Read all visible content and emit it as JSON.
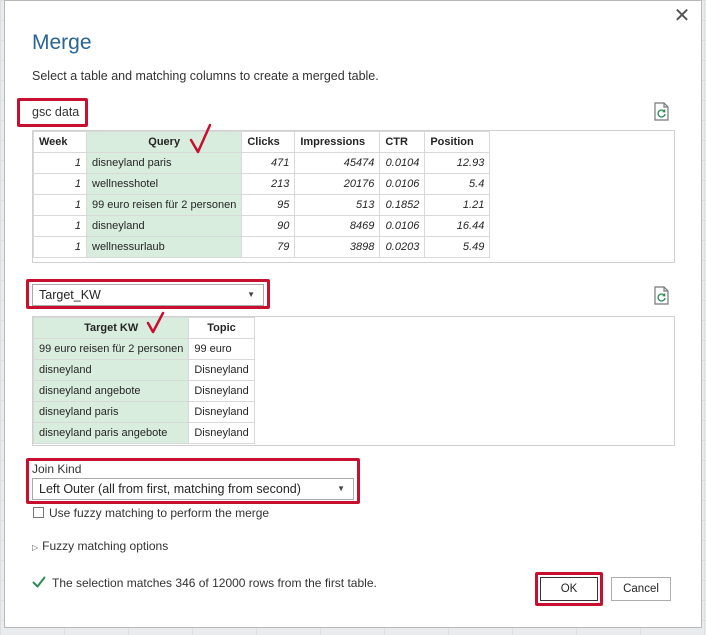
{
  "dialog": {
    "title": "Merge",
    "subtitle": "Select a table and matching columns to create a merged table.",
    "close_glyph": "✕"
  },
  "first_table": {
    "name": "gsc data",
    "columns": [
      "Week",
      "Query",
      "Clicks",
      "Impressions",
      "CTR",
      "Position"
    ],
    "rows": [
      [
        "1",
        "disneyland paris",
        "471",
        "45474",
        "0.0104",
        "12.93"
      ],
      [
        "1",
        "wellnesshotel",
        "213",
        "20176",
        "0.0106",
        "5.4"
      ],
      [
        "1",
        "99 euro reisen für 2 personen",
        "95",
        "513",
        "0.1852",
        "1.21"
      ],
      [
        "1",
        "disneyland",
        "90",
        "8469",
        "0.0106",
        "16.44"
      ],
      [
        "1",
        "wellnessurlaub",
        "79",
        "3898",
        "0.0203",
        "5.49"
      ]
    ]
  },
  "second_table": {
    "selected": "Target_KW",
    "columns": [
      "Target KW",
      "Topic"
    ],
    "rows": [
      [
        "99 euro reisen für 2 personen",
        "99 euro"
      ],
      [
        "disneyland",
        "Disneyland"
      ],
      [
        "disneyland angebote",
        "Disneyland"
      ],
      [
        "disneyland paris",
        "Disneyland"
      ],
      [
        "disneyland paris angebote",
        "Disneyland"
      ]
    ]
  },
  "join": {
    "label": "Join Kind",
    "value": "Left Outer (all from first, matching from second)"
  },
  "fuzzy": {
    "checkbox_label": "Use fuzzy matching to perform the merge",
    "checked": false,
    "options_label": "Fuzzy matching options"
  },
  "status": {
    "text": "The selection matches 346 of 12000 rows from the first table."
  },
  "buttons": {
    "ok": "OK",
    "cancel": "Cancel"
  },
  "colors": {
    "title": "#2a6496",
    "selected_column": "#d9eddf",
    "annotation_red": "#c8102e",
    "check_green": "#2e8b57"
  }
}
